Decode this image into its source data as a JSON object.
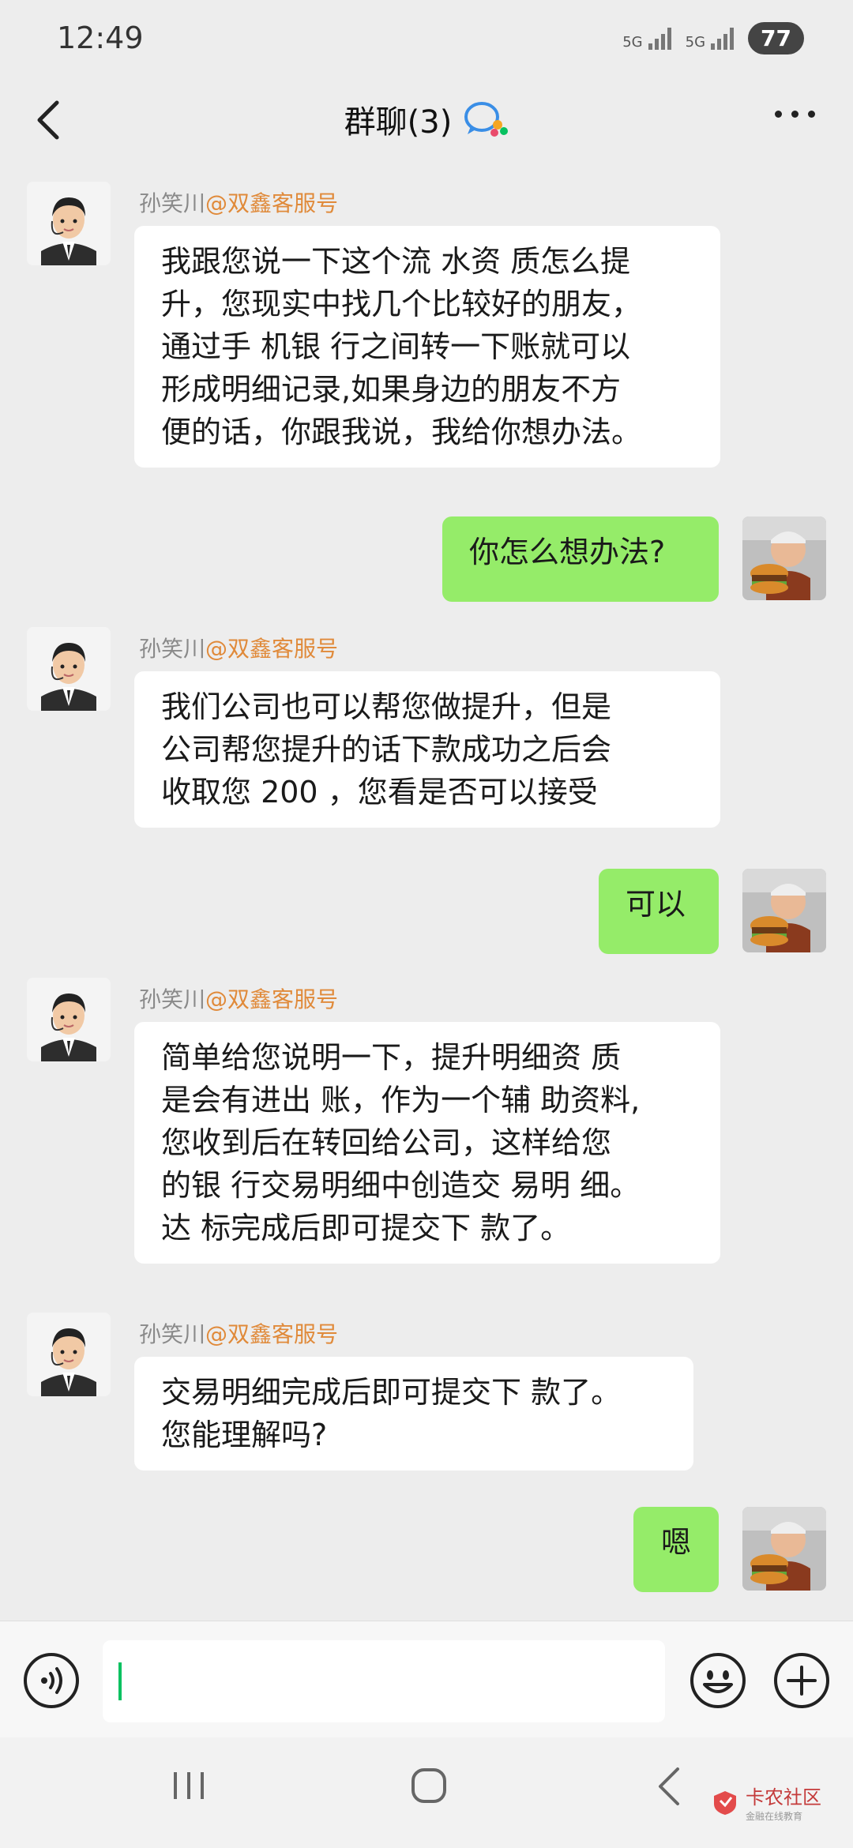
{
  "status": {
    "time": "12:49",
    "network_1": "5G",
    "network_2": "5G",
    "battery": "77"
  },
  "header": {
    "title": "群聊(3)"
  },
  "messages": [
    {
      "side": "left",
      "sender_name": "孙笑川",
      "sender_org": "@双鑫客服号",
      "lines": [
        "我跟您说一下这个流 水资 质怎么提",
        "升，您现实中找几个比较好的朋友，",
        "通过手 机银 行之间转一下账就可以",
        "形成明细记录,如果身边的朋友不方",
        "便的话，你跟我说，我给你想办法。"
      ]
    },
    {
      "side": "right",
      "lines": [
        "你怎么想办法?"
      ]
    },
    {
      "side": "left",
      "sender_name": "孙笑川",
      "sender_org": "@双鑫客服号",
      "lines": [
        "我们公司也可以帮您做提升，但是",
        "公司帮您提升的话下款成功之后会",
        "收取您 200 ，您看是否可以接受"
      ]
    },
    {
      "side": "right",
      "lines": [
        "可以"
      ]
    },
    {
      "side": "left",
      "sender_name": "孙笑川",
      "sender_org": "@双鑫客服号",
      "lines": [
        "简单给您说明一下，提升明细资 质",
        "是会有进出 账，作为一个辅 助资料,",
        "您收到后在转回给公司，这样给您",
        "的银 行交易明细中创造交 易明 细。",
        "达 标完成后即可提交下 款了。"
      ]
    },
    {
      "side": "left",
      "sender_name": "孙笑川",
      "sender_org": "@双鑫客服号",
      "lines": [
        "交易明细完成后即可提交下 款了。",
        "您能理解吗?"
      ]
    },
    {
      "side": "right",
      "lines": [
        "嗯"
      ]
    }
  ],
  "input": {
    "placeholder": ""
  },
  "watermark": {
    "name": "卡农社区",
    "tagline": "金融在线教育"
  },
  "colors": {
    "background": "#ededed",
    "self_bubble": "#95ec69",
    "other_bubble": "#ffffff",
    "sender_org": "#e08a3a",
    "accent": "#07c160"
  }
}
